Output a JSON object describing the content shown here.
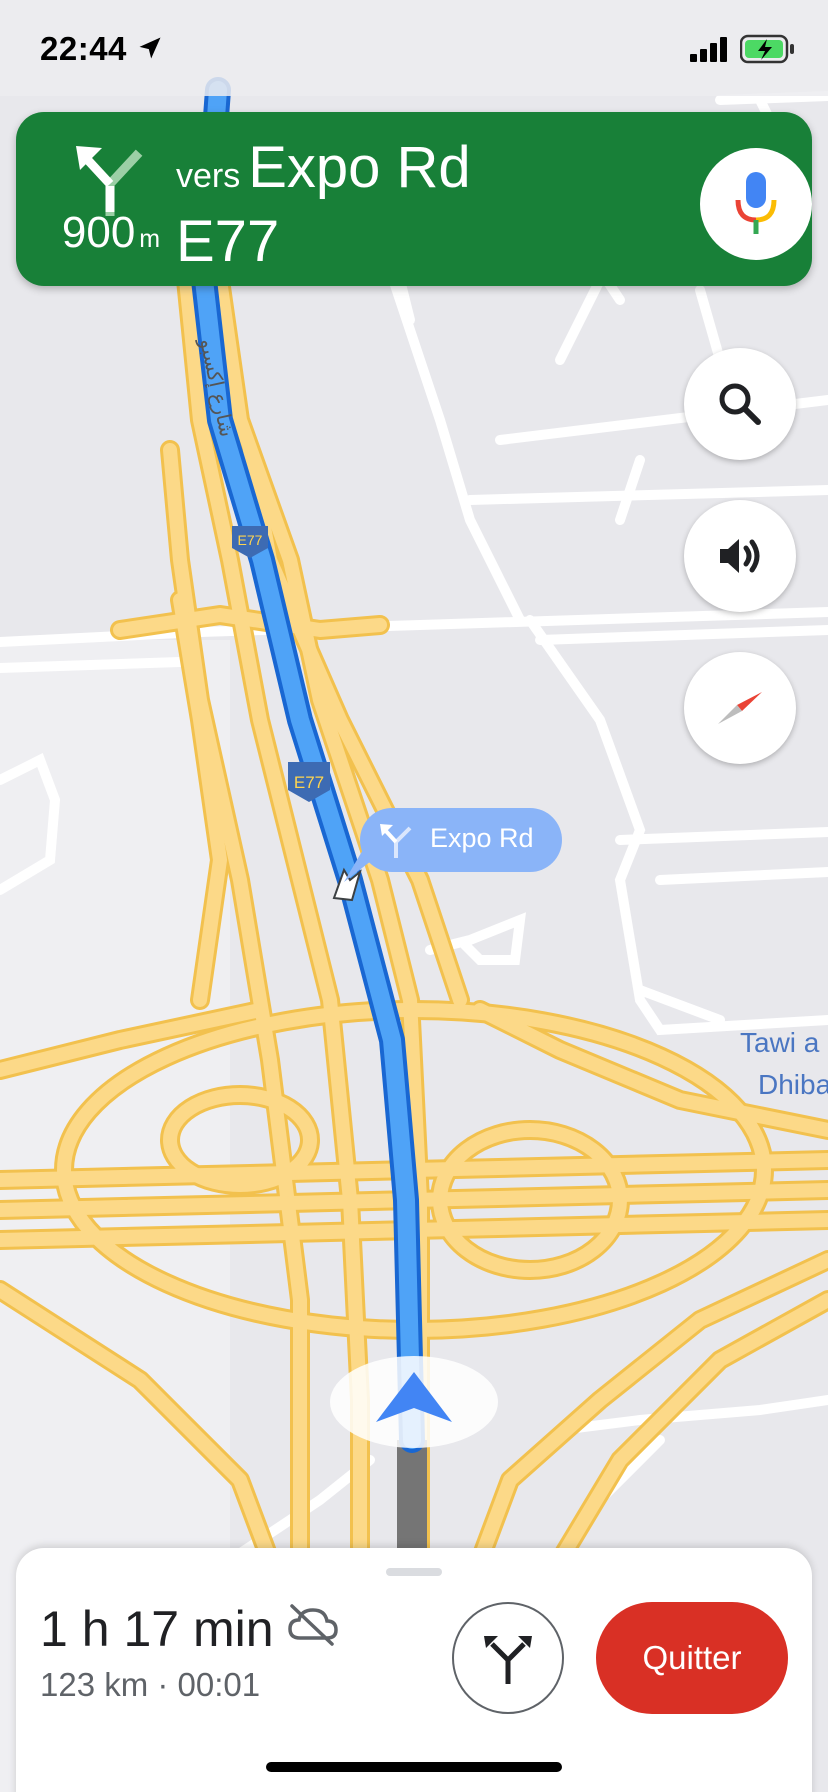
{
  "status": {
    "time": "22:44"
  },
  "nav": {
    "distance_value": "900",
    "distance_unit": "m",
    "instruction_prefix": "vers",
    "street_name": "Expo Rd",
    "road_code": "E77"
  },
  "map": {
    "road_shields": [
      "E77",
      "E77"
    ],
    "callout_label": "Expo Rd",
    "place_label_line1": "Tawi a",
    "place_label_line2": "Dhiba",
    "arabic_road_name": "شارع إكسبو"
  },
  "trip": {
    "duration_hours": "1",
    "hours_unit": "h",
    "duration_minutes": "17",
    "minutes_unit": "min",
    "details": "123 km · 00:01",
    "quit_label": "Quitter"
  },
  "colors": {
    "banner_green": "#188038",
    "route_blue": "#4285f4",
    "route_blue_light": "#8ab4f8",
    "highway_yellow": "#fcd375",
    "quit_red": "#d93025"
  },
  "icons": [
    "location-arrow-icon",
    "signal-icon",
    "battery-charging-icon",
    "fork-left-turn-icon",
    "microphone-icon",
    "search-icon",
    "volume-icon",
    "compass-icon",
    "weather-cloud-off-icon",
    "alternate-routes-icon",
    "nav-arrow-icon"
  ]
}
